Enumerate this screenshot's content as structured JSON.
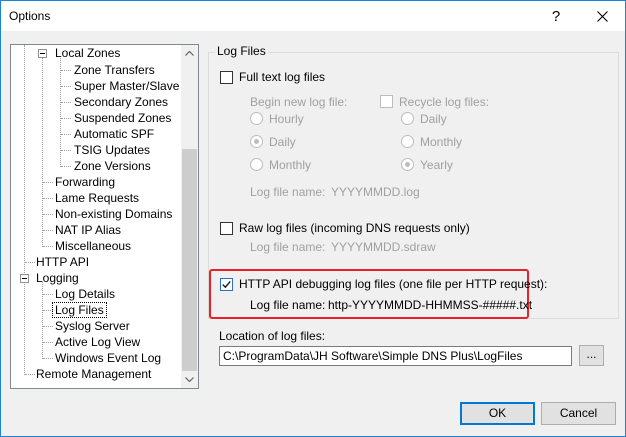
{
  "window": {
    "title": "Options",
    "help_label": "?",
    "close_label": "✕"
  },
  "tree": {
    "items": [
      {
        "label": "Local Zones",
        "level": 1,
        "expanded": true
      },
      {
        "label": "Zone Transfers",
        "level": 2
      },
      {
        "label": "Super Master/Slave",
        "level": 2
      },
      {
        "label": "Secondary Zones",
        "level": 2
      },
      {
        "label": "Suspended Zones",
        "level": 2
      },
      {
        "label": "Automatic SPF",
        "level": 2
      },
      {
        "label": "TSIG Updates",
        "level": 2
      },
      {
        "label": "Zone Versions",
        "level": 2
      },
      {
        "label": "Forwarding",
        "level": 1
      },
      {
        "label": "Lame Requests",
        "level": 1
      },
      {
        "label": "Non-existing Domains",
        "level": 1
      },
      {
        "label": "NAT IP Alias",
        "level": 1
      },
      {
        "label": "Miscellaneous",
        "level": 1
      },
      {
        "label": "HTTP API",
        "level": 0
      },
      {
        "label": "Logging",
        "level": 0,
        "expanded": true
      },
      {
        "label": "Log Details",
        "level": 1
      },
      {
        "label": "Log Files",
        "level": 1,
        "selected": true
      },
      {
        "label": "Syslog Server",
        "level": 1
      },
      {
        "label": "Active Log View",
        "level": 1
      },
      {
        "label": "Windows Event Log",
        "level": 1
      },
      {
        "label": "Remote Management",
        "level": 0
      }
    ]
  },
  "log_files": {
    "group_title": "Log Files",
    "full_text": {
      "label": "Full text log files",
      "checked": false,
      "begin_new_label": "Begin new log file:",
      "begin_new_options": [
        "Hourly",
        "Daily",
        "Monthly"
      ],
      "begin_new_selected": "Daily",
      "recycle_label": "Recycle log files:",
      "recycle_checked": false,
      "recycle_options": [
        "Daily",
        "Monthly",
        "Yearly"
      ],
      "recycle_selected": "Yearly",
      "name_label": "Log file name:",
      "name_value": "YYYYMMDD.log"
    },
    "raw": {
      "label": "Raw log files (incoming DNS requests only)",
      "checked": false,
      "name_label": "Log file name:",
      "name_value": "YYYYMMDD.sdraw"
    },
    "http_api": {
      "label": "HTTP API debugging log files (one file per HTTP request):",
      "checked": true,
      "name_label": "Log file name:",
      "name_value": "http-YYYYMMDD-HHMMSS-#####.txt"
    },
    "location_label": "Location of log files:",
    "location_value": "C:\\ProgramData\\JH Software\\Simple DNS Plus\\LogFiles",
    "browse_label": "..."
  },
  "buttons": {
    "ok": "OK",
    "cancel": "Cancel"
  },
  "colors": {
    "accent": "#0078d7",
    "highlight_border": "#e8212b",
    "title_border": "#1883d7"
  }
}
